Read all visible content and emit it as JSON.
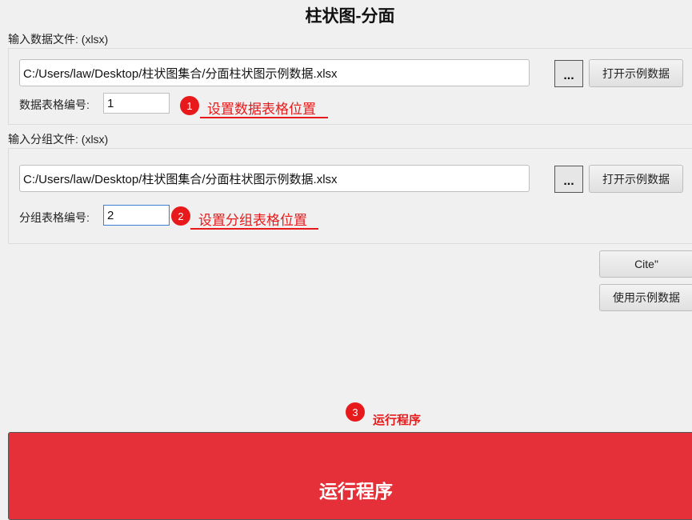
{
  "window": {
    "title": "柱状图-分面"
  },
  "data_file": {
    "section_label": "输入数据文件: (xlsx)",
    "path_value": "C:/Users/law/Desktop/柱状图集合/分面柱状图示例数据.xlsx",
    "browse_label": "...",
    "open_sample_label": "打开示例数据",
    "sheet_label": "数据表格编号:",
    "sheet_value": "1"
  },
  "group_file": {
    "section_label": "输入分组文件: (xlsx)",
    "path_value": "C:/Users/law/Desktop/柱状图集合/分面柱状图示例数据.xlsx",
    "browse_label": "...",
    "open_sample_label": "打开示例数据",
    "sheet_label": "分组表格编号:",
    "sheet_value": "2"
  },
  "side_buttons": {
    "cite_label": "Cite\"",
    "use_sample_label": "使用示例数据"
  },
  "annotations": {
    "step1": {
      "number": "1",
      "text": "设置数据表格位置"
    },
    "step2": {
      "number": "2",
      "text": "设置分组表格位置"
    },
    "step3": {
      "number": "3",
      "text": "运行程序"
    }
  },
  "run": {
    "label": "运行程序"
  },
  "colors": {
    "accent_red": "#e8191a",
    "run_button": "#e5303a",
    "focus_border": "#3c7fd6"
  }
}
